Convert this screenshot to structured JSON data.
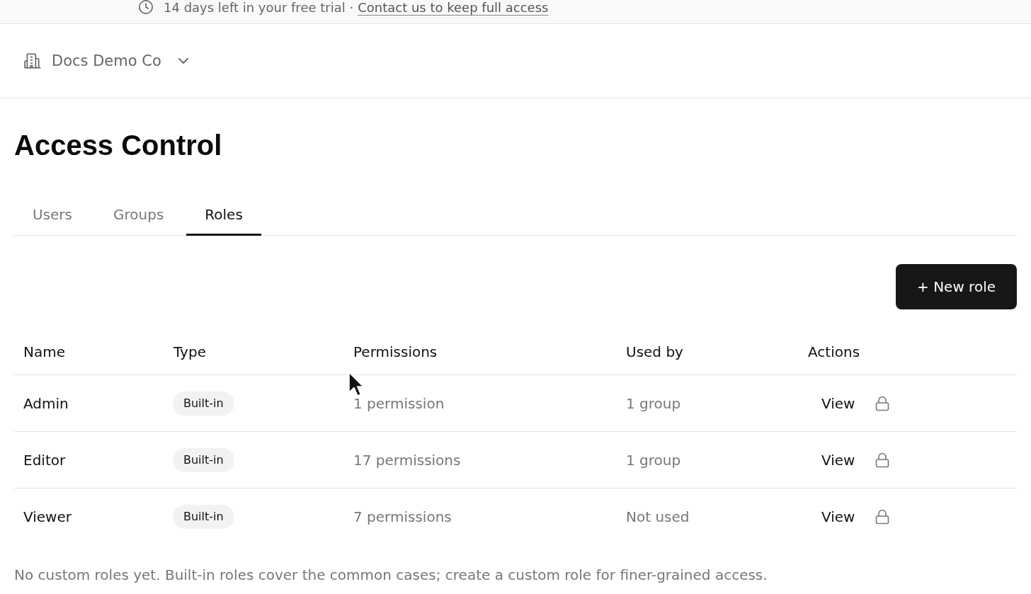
{
  "trial_banner": {
    "message": "14 days left in your free trial ·",
    "link": "Contact us to keep full access"
  },
  "org_switcher": {
    "name": "Docs Demo Co"
  },
  "page": {
    "title": "Access Control"
  },
  "tabs": [
    {
      "label": "Users",
      "selected": false
    },
    {
      "label": "Groups",
      "selected": false
    },
    {
      "label": "Roles",
      "selected": true
    }
  ],
  "new_role_button": {
    "label": "+ New role"
  },
  "table": {
    "columns": [
      "Name",
      "Type",
      "Permissions",
      "Used by",
      "Actions"
    ],
    "rows": [
      {
        "name": "Admin",
        "type": "Built-in",
        "permissions": "1 permission",
        "used_by": "1 group",
        "action": "View",
        "locked": true
      },
      {
        "name": "Editor",
        "type": "Built-in",
        "permissions": "17 permissions",
        "used_by": "1 group",
        "action": "View",
        "locked": true
      },
      {
        "name": "Viewer",
        "type": "Built-in",
        "permissions": "7 permissions",
        "used_by": "Not used",
        "action": "View",
        "locked": true
      }
    ]
  },
  "footer_note": "No custom roles yet. Built-in roles cover the common cases; create a custom role for finer-grained access."
}
